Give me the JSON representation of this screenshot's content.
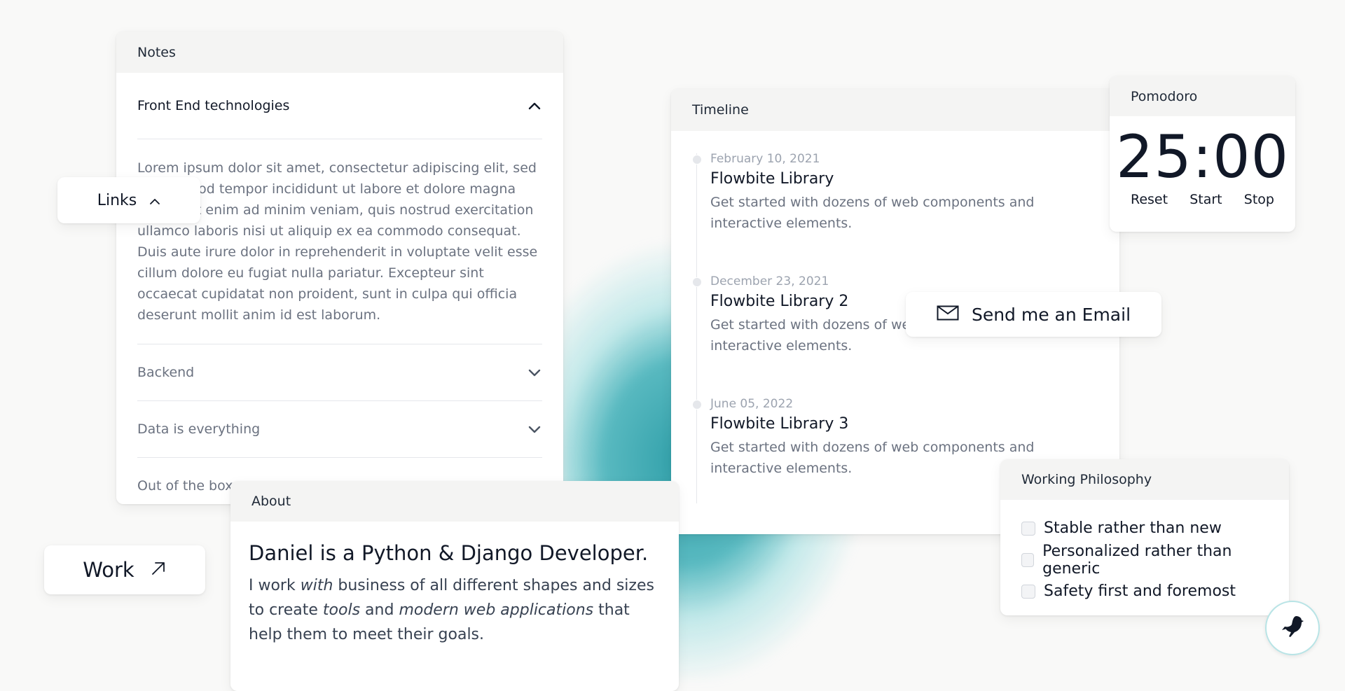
{
  "notes": {
    "title": "Notes",
    "open_item": {
      "label": "Front End technologies",
      "body": "Lorem ipsum dolor sit amet, consectetur adipiscing elit, sed do eiusmod tempor incididunt ut labore et dolore magna aliqua. Ut enim ad minim veniam, quis nostrud exercitation ullamco laboris nisi ut aliquip ex ea commodo consequat. Duis aute irure dolor in reprehenderit in voluptate velit esse cillum dolore eu fugiat nulla pariatur. Excepteur sint occaecat cupidatat non proident, sunt in culpa qui officia deserunt mollit anim id est laborum."
    },
    "items": [
      {
        "label": "Backend"
      },
      {
        "label": "Data is everything"
      },
      {
        "label": "Out of the box"
      }
    ]
  },
  "links": {
    "label": "Links",
    "icon": "chevron-up-icon"
  },
  "work": {
    "label": "Work",
    "icon": "arrow-up-right-icon"
  },
  "timeline": {
    "title": "Timeline",
    "items": [
      {
        "date": "February 10, 2021",
        "title": "Flowbite Library",
        "desc": "Get started with dozens of web components and interactive elements."
      },
      {
        "date": "December 23, 2021",
        "title": "Flowbite Library 2",
        "desc": "Get started with dozens of web components and interactive elements."
      },
      {
        "date": "June 05, 2022",
        "title": "Flowbite Library 3",
        "desc": "Get started with dozens of web components and interactive elements."
      }
    ]
  },
  "pomodoro": {
    "title": "Pomodoro",
    "time": "25:00",
    "reset": "Reset",
    "start": "Start",
    "stop": "Stop"
  },
  "email": {
    "label": "Send me an Email",
    "icon": "envelope-icon"
  },
  "about": {
    "title": "About",
    "headline": "Daniel is a Python & Django Developer.",
    "text_parts": [
      "I work ",
      "with",
      " business of all different shapes and sizes to create ",
      "tools",
      " and ",
      "modern web applications",
      " that help them to meet their goals."
    ]
  },
  "philosophy": {
    "title": "Working Philosophy",
    "items": [
      {
        "label": "Stable rather than new",
        "checked": false
      },
      {
        "label": "Personalized rather than generic",
        "checked": false
      },
      {
        "label": "Safety first and foremost",
        "checked": false
      }
    ]
  },
  "fab": {
    "icon": "bird-icon"
  },
  "colors": {
    "accent": "#2e9ea8",
    "header_bg": "#f4f4f3",
    "page_bg": "#f9f9f8"
  }
}
